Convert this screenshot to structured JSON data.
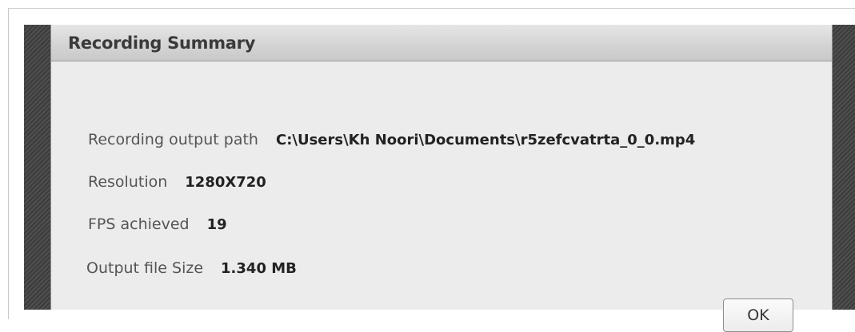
{
  "dialog": {
    "title": "Recording Summary",
    "ok_label": "OK"
  },
  "summary": {
    "output_path": {
      "label": "Recording output path",
      "value": "C:\\Users\\Kh Noori\\Documents\\r5zefcvatrta_0_0.mp4"
    },
    "resolution": {
      "label": "Resolution",
      "value": "1280X720"
    },
    "fps": {
      "label": "FPS achieved",
      "value": "19"
    },
    "file_size": {
      "label": "Output file Size",
      "value": "1.340 MB"
    }
  }
}
